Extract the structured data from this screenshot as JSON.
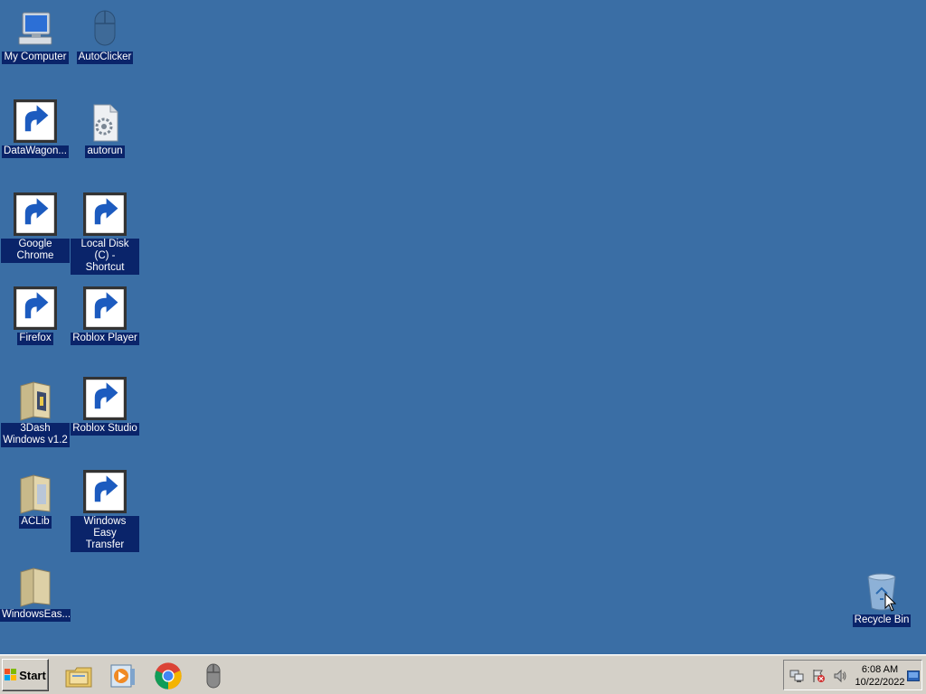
{
  "desktop": {
    "icons": [
      {
        "label": "My Computer",
        "icon": "computer-icon",
        "shortcut": false
      },
      {
        "label": "AutoClicker",
        "icon": "mouse-icon",
        "shortcut": false
      },
      {
        "label": "DataWagon...",
        "icon": "datawagon-icon",
        "shortcut": true
      },
      {
        "label": "autorun",
        "icon": "settings-file-icon",
        "shortcut": false
      },
      {
        "label": "Google Chrome",
        "icon": "chrome-icon",
        "shortcut": true
      },
      {
        "label": "Local Disk (C) -\nShortcut",
        "icon": "drive-icon",
        "shortcut": true
      },
      {
        "label": "Firefox",
        "icon": "firefox-icon",
        "shortcut": true
      },
      {
        "label": "Roblox Player",
        "icon": "roblox-player-icon",
        "shortcut": true
      },
      {
        "label": "3Dash\nWindows v1.2",
        "icon": "folder-icon",
        "shortcut": false
      },
      {
        "label": "Roblox Studio",
        "icon": "roblox-studio-icon",
        "shortcut": true
      },
      {
        "label": "ACLib",
        "icon": "folder-icon",
        "shortcut": false
      },
      {
        "label": "Windows Easy\nTransfer",
        "icon": "easy-transfer-icon",
        "shortcut": true
      },
      {
        "label": "WindowsEas...",
        "icon": "folder-icon",
        "shortcut": false
      },
      {
        "label": "Recycle Bin",
        "icon": "recycle-bin-icon",
        "shortcut": false
      }
    ]
  },
  "taskbar": {
    "start_label": "Start",
    "quick_launch": [
      "file-explorer-icon",
      "media-player-icon",
      "chrome-icon",
      "mouse-icon"
    ],
    "tray_icons": [
      "network-icon",
      "action-center-icon",
      "volume-icon"
    ],
    "clock_time": "6:08 AM",
    "clock_date": "10/22/2022"
  },
  "colors": {
    "desktop_background": "#3a6ea5",
    "label_highlight": "#0a246a",
    "taskbar": "#d4d0c8"
  }
}
